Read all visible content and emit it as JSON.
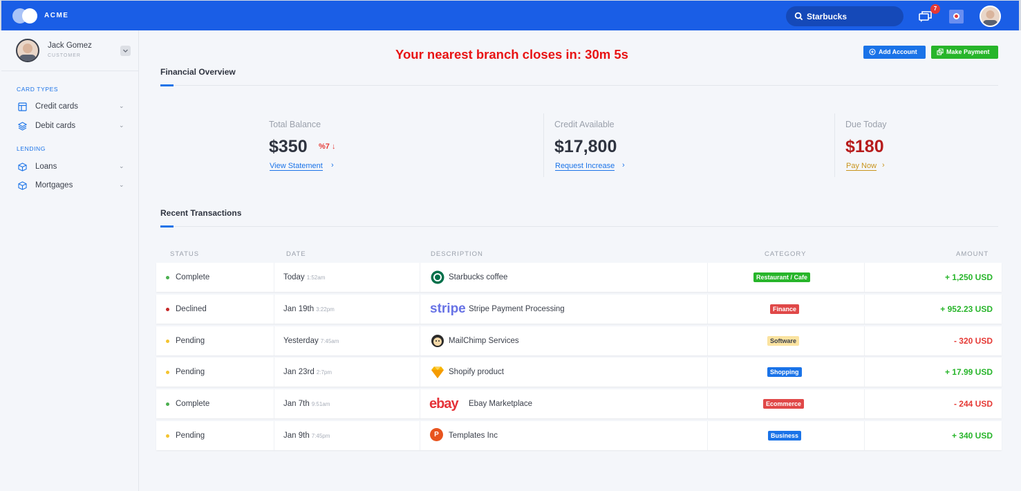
{
  "app": {
    "brand": "ACME"
  },
  "topbar": {
    "search_value": "Starbucks",
    "notification_count": "7"
  },
  "user": {
    "name": "Jack Gomez",
    "role": "CUSTOMER"
  },
  "sidebar": {
    "sections": [
      {
        "label": "CARD TYPES",
        "items": [
          {
            "label": "Credit cards",
            "icon": "card-icon"
          },
          {
            "label": "Debit cards",
            "icon": "layers-icon"
          }
        ]
      },
      {
        "label": "LENDING",
        "items": [
          {
            "label": "Loans",
            "icon": "box-icon"
          },
          {
            "label": "Mortgages",
            "icon": "box-icon"
          }
        ]
      }
    ]
  },
  "banner": {
    "countdown": "Your nearest branch closes in: 30m 5s"
  },
  "actions": {
    "add_account": "Add Account",
    "make_payment": "Make Payment"
  },
  "overview": {
    "title": "Financial Overview",
    "stats": [
      {
        "label": "Total Balance",
        "value": "$350",
        "delta": "%7",
        "link": "View Statement"
      },
      {
        "label": "Credit Available",
        "value": "$17,800",
        "link": "Request Increase"
      },
      {
        "label": "Due Today",
        "value": "$180",
        "link": "Pay Now"
      }
    ]
  },
  "transactions": {
    "title": "Recent Transactions",
    "columns": [
      "STATUS",
      "DATE",
      "DESCRIPTION",
      "CATEGORY",
      "AMOUNT"
    ],
    "rows": [
      {
        "status": "Complete",
        "date": "Today",
        "time": "1:52am",
        "description": "Starbucks coffee",
        "logo": "starbucks-logo",
        "category": "Restaurant / Cafe",
        "amount": "+ 1,250 USD"
      },
      {
        "status": "Declined",
        "date": "Jan 19th",
        "time": "3:22pm",
        "description": "Stripe Payment Processing",
        "logo": "stripe-logo",
        "logo_text": "stripe",
        "category": "Finance",
        "amount": "+ 952.23 USD"
      },
      {
        "status": "Pending",
        "date": "Yesterday",
        "time": "7:45am",
        "description": "MailChimp Services",
        "logo": "mailchimp-logo",
        "category": "Software",
        "amount": "- 320 USD"
      },
      {
        "status": "Pending",
        "date": "Jan 23rd",
        "time": "2:7pm",
        "description": "Shopify product",
        "logo": "shopify-logo",
        "category": "Shopping",
        "amount": "+ 17.99 USD"
      },
      {
        "status": "Complete",
        "date": "Jan 7th",
        "time": "9:51am",
        "description": "Ebay Marketplace",
        "logo": "ebay-logo",
        "logo_text": "ebay",
        "category": "Ecommerce",
        "amount": "- 244 USD"
      },
      {
        "status": "Pending",
        "date": "Jan 9th",
        "time": "7:45pm",
        "description": "Templates Inc",
        "logo": "templates-logo",
        "logo_text": "P",
        "category": "Business",
        "amount": "+ 340 USD"
      }
    ]
  },
  "colors": {
    "primary": "#1a5ee6",
    "accent": "#1a73e8",
    "success": "#27b52a",
    "danger": "#e53935",
    "due": "#b71c1c",
    "warning": "#f4c430"
  }
}
